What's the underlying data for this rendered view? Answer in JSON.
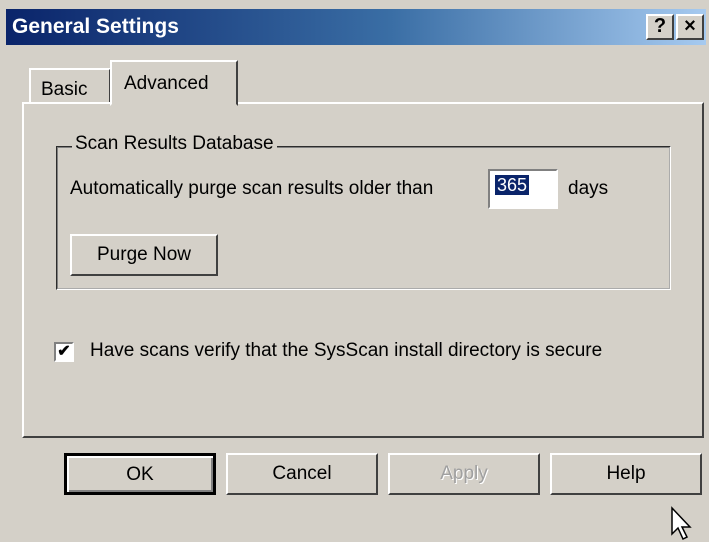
{
  "window": {
    "title": "General Settings",
    "help_button": "?",
    "close_button": "×"
  },
  "tabs": [
    {
      "label": "Basic",
      "active": false
    },
    {
      "label": "Advanced",
      "active": true
    }
  ],
  "scan_results_database": {
    "legend": "Scan Results Database",
    "purge_label": "Automatically purge scan results older than",
    "days_value": "365",
    "days_unit": "days",
    "purge_now_label": "Purge Now"
  },
  "verify_checkbox": {
    "checked": true,
    "label": "Have scans verify that the SysScan install directory is secure"
  },
  "footer": {
    "ok_label": "OK",
    "cancel_label": "Cancel",
    "apply_label": "Apply",
    "help_label": "Help"
  },
  "colors": {
    "titlebar_start": "#0a246a",
    "titlebar_end": "#a6caf0",
    "dialog_bg": "#d4d0c8",
    "selection": "#0a246a"
  }
}
